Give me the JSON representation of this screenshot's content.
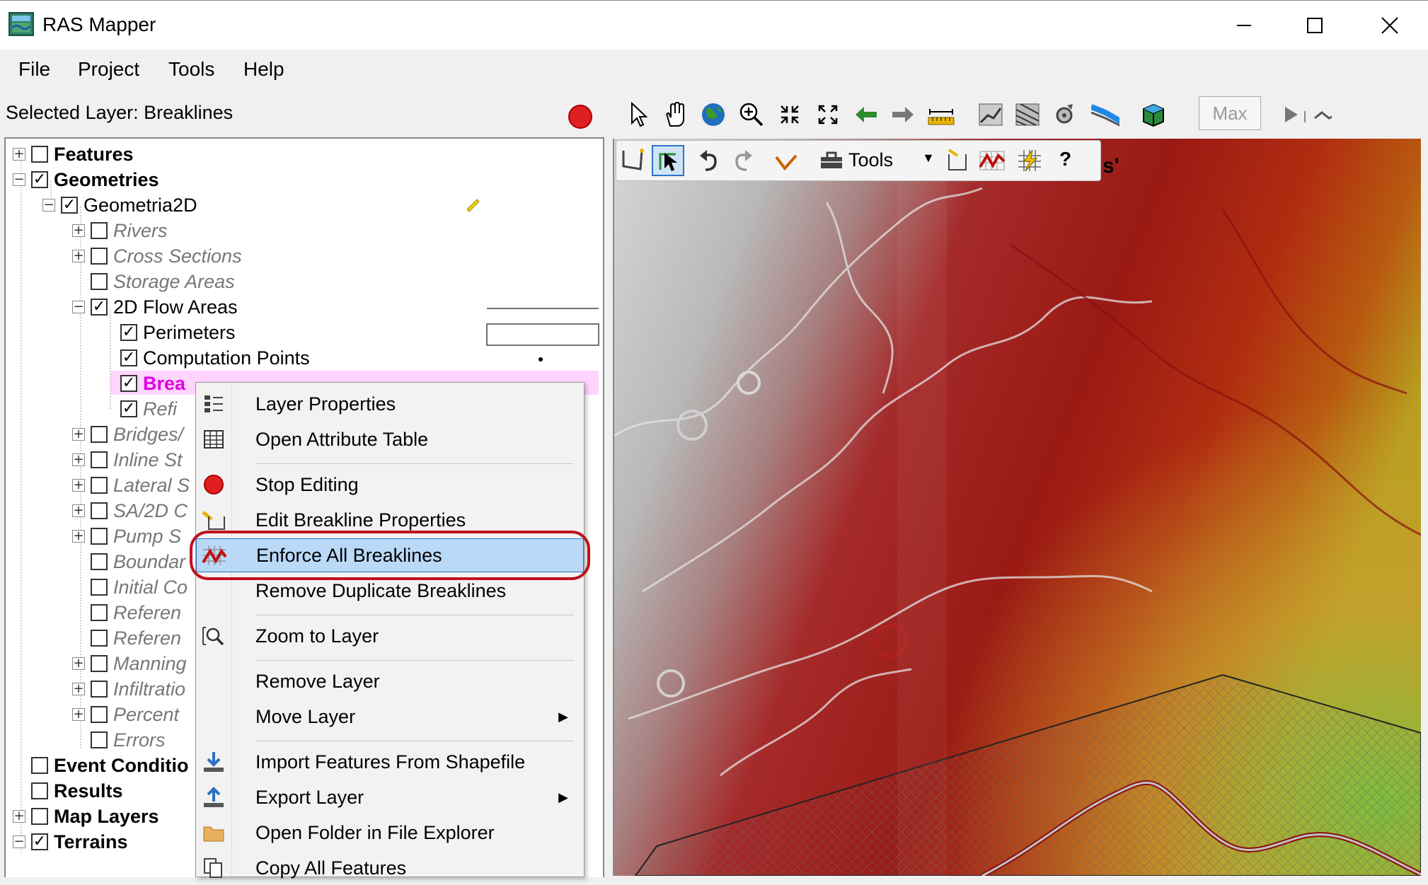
{
  "window": {
    "title": "RAS Mapper",
    "minimize": "—",
    "maximize": "☐",
    "close": "✕"
  },
  "menubar": {
    "items": [
      "File",
      "Project",
      "Tools",
      "Help"
    ]
  },
  "selected_layer": {
    "text": "Selected Layer: Breaklines"
  },
  "tree": {
    "rows": [
      {
        "label": "Features",
        "checked": false,
        "expander": "+"
      },
      {
        "label": "Geometries",
        "checked": true,
        "expander": "−"
      },
      {
        "label": "Geometria2D",
        "checked": true,
        "expander": "−"
      },
      {
        "label": "Rivers",
        "checked": false,
        "expander": "+"
      },
      {
        "label": "Cross Sections",
        "checked": false,
        "expander": "+"
      },
      {
        "label": "Storage Areas",
        "checked": false,
        "expander": ""
      },
      {
        "label": "2D Flow Areas",
        "checked": true,
        "expander": "−"
      },
      {
        "label": "Perimeters",
        "checked": true,
        "expander": ""
      },
      {
        "label": "Computation Points",
        "checked": true,
        "expander": ""
      },
      {
        "label": "Brea",
        "checked": true,
        "expander": ""
      },
      {
        "label": "Refi",
        "checked": true,
        "expander": ""
      },
      {
        "label": "Bridges/",
        "checked": false,
        "expander": "+"
      },
      {
        "label": "Inline St",
        "checked": false,
        "expander": "+"
      },
      {
        "label": "Lateral S",
        "checked": false,
        "expander": "+"
      },
      {
        "label": "SA/2D C",
        "checked": false,
        "expander": "+"
      },
      {
        "label": "Pump S",
        "checked": false,
        "expander": "+"
      },
      {
        "label": "Boundar",
        "checked": false,
        "expander": ""
      },
      {
        "label": "Initial Co",
        "checked": false,
        "expander": ""
      },
      {
        "label": "Referen",
        "checked": false,
        "expander": ""
      },
      {
        "label": "Referen",
        "checked": false,
        "expander": ""
      },
      {
        "label": "Manning",
        "checked": false,
        "expander": "+"
      },
      {
        "label": "Infiltratio",
        "checked": false,
        "expander": "+"
      },
      {
        "label": "Percent",
        "checked": false,
        "expander": "+"
      },
      {
        "label": "Errors",
        "checked": false,
        "expander": ""
      },
      {
        "label": "Event Conditio",
        "checked": false,
        "expander": ""
      },
      {
        "label": "Results",
        "checked": false,
        "expander": ""
      },
      {
        "label": "Map Layers",
        "checked": false,
        "expander": "+"
      },
      {
        "label": "Terrains",
        "checked": true,
        "expander": "−"
      }
    ]
  },
  "map_toolbar": {
    "max_label": "Max"
  },
  "edit_toolbar": {
    "tools_label": "Tools",
    "help_label": "?"
  },
  "map": {
    "overlay_text": "s'"
  },
  "context_menu": {
    "items": [
      {
        "label": "Layer Properties",
        "icon": "layer-properties-icon"
      },
      {
        "label": "Open Attribute Table",
        "icon": "table-icon"
      },
      {
        "label": "Stop Editing",
        "icon": "stop-editing-icon"
      },
      {
        "label": "Edit Breakline Properties",
        "icon": "edit-breakline-icon"
      },
      {
        "label": "Enforce All Breaklines",
        "icon": "enforce-breaklines-icon"
      },
      {
        "label": "Remove Duplicate Breaklines",
        "icon": ""
      },
      {
        "label": "Zoom to Layer",
        "icon": "zoom-layer-icon"
      },
      {
        "label": "Remove Layer",
        "icon": ""
      },
      {
        "label": "Move Layer",
        "icon": ""
      },
      {
        "label": "Import Features From Shapefile",
        "icon": "import-icon"
      },
      {
        "label": "Export Layer",
        "icon": "export-icon"
      },
      {
        "label": "Open Folder in File Explorer",
        "icon": "folder-icon"
      },
      {
        "label": "Copy All Features",
        "icon": "copy-icon"
      }
    ],
    "highlighted": "Enforce All Breaklines"
  },
  "colors": {
    "highlight_bg": "#b9d9f7",
    "highlight_border": "#2c74c9",
    "annotation_ring": "#c0121c",
    "selected_layer_text": "#e000e0"
  }
}
